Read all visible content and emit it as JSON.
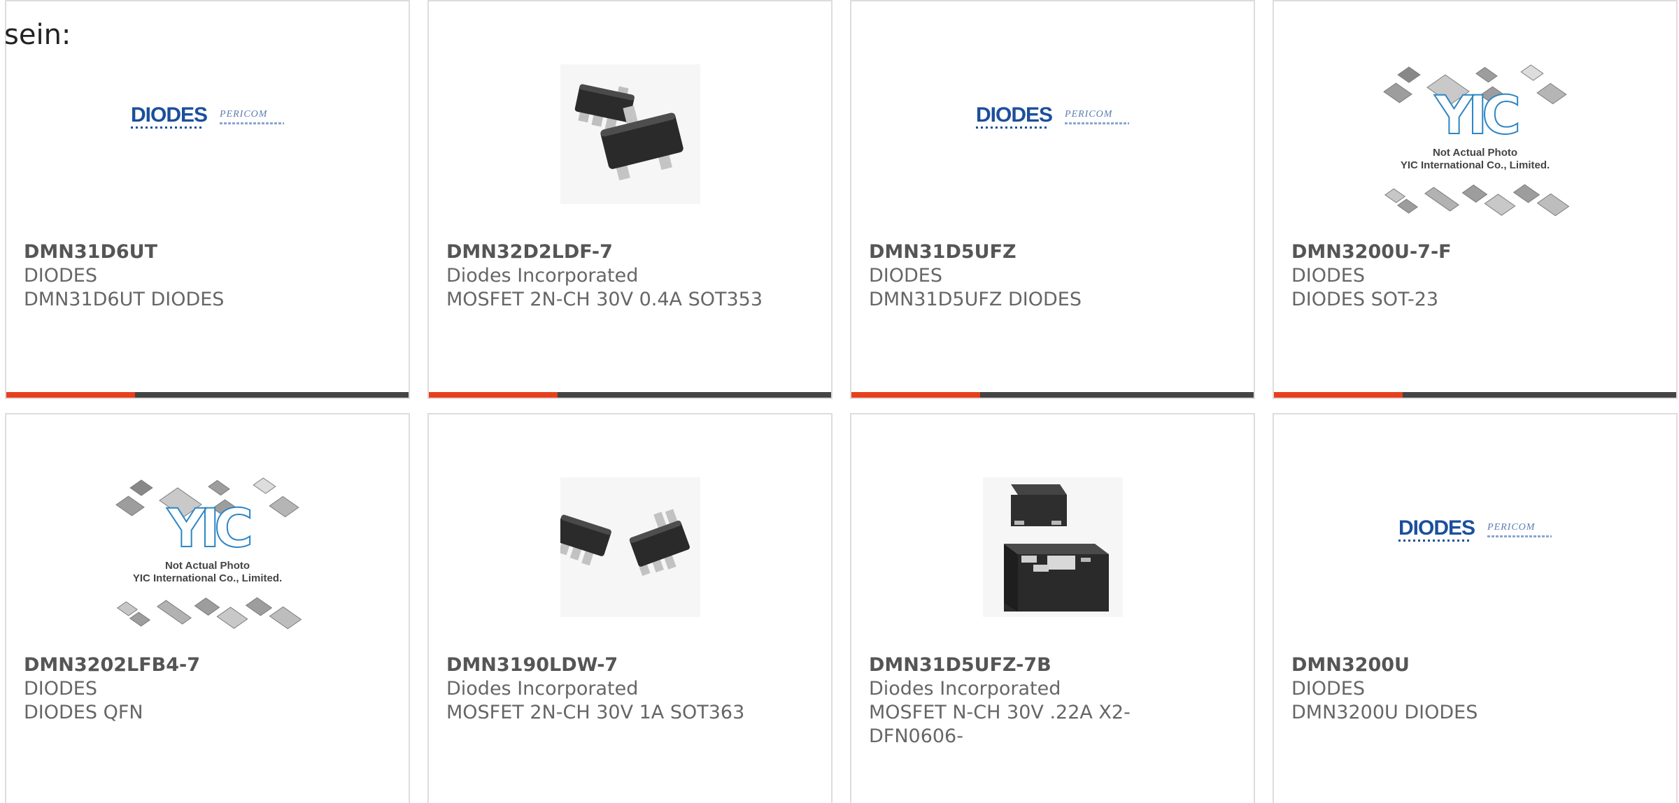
{
  "intro_text": "sein:",
  "colors": {
    "accent": "#e8401c",
    "bar": "#444444",
    "border": "#dddddd",
    "text": "#666666"
  },
  "image_captions": {
    "yic_logo": "YIC",
    "yic_line1": "Not Actual Photo",
    "yic_line2": "YIC International Co., Limited.",
    "diodes_logo": "DIODES",
    "pericom_logo": "PERICOM"
  },
  "products": [
    {
      "part": "DMN31D6UT",
      "maker": "DIODES",
      "desc": "DMN31D6UT DIODES",
      "image": "diodes-pericom-logo",
      "progress": 0.32
    },
    {
      "part": "DMN32D2LDF-7",
      "maker": "Diodes Incorporated",
      "desc": "MOSFET 2N-CH 30V 0.4A SOT353",
      "image": "sot353-chip-photo",
      "progress": 0.32
    },
    {
      "part": "DMN31D5UFZ",
      "maker": "DIODES",
      "desc": "DMN31D5UFZ DIODES",
      "image": "diodes-pericom-logo",
      "progress": 0.32
    },
    {
      "part": "DMN3200U-7-F",
      "maker": "DIODES",
      "desc": "DIODES SOT-23",
      "image": "yic-placeholder",
      "progress": 0.32
    },
    {
      "part": "DMN3202LFB4-7",
      "maker": "DIODES",
      "desc": "DIODES QFN",
      "image": "yic-placeholder",
      "progress": 0
    },
    {
      "part": "DMN3190LDW-7",
      "maker": "Diodes Incorporated",
      "desc": "MOSFET 2N-CH 30V 1A SOT363",
      "image": "sot363-chip-photo",
      "progress": 0
    },
    {
      "part": "DMN31D5UFZ-7B",
      "maker": "Diodes Incorporated",
      "desc": "MOSFET N-CH 30V .22A X2-DFN0606-",
      "image": "dfn-chip-photo",
      "progress": 0
    },
    {
      "part": "DMN3200U",
      "maker": "DIODES",
      "desc": "DMN3200U DIODES",
      "image": "diodes-pericom-logo",
      "progress": 0
    }
  ]
}
